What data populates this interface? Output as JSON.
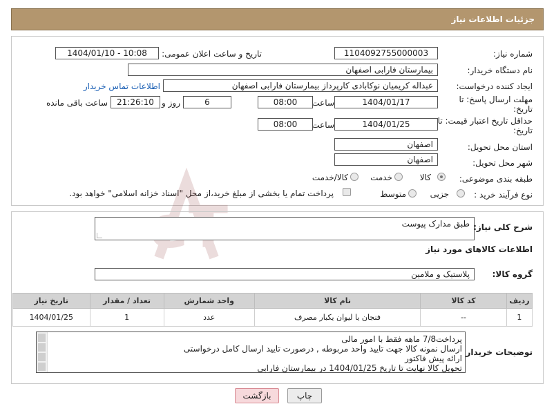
{
  "header": {
    "title": "جزئیات اطلاعات نیاز"
  },
  "form": {
    "need_number_label": "شماره نیاز:",
    "need_number": "1104092755000003",
    "announce_label": "تاریخ و ساعت اعلان عمومی:",
    "announce_value": "1404/01/10 - 10:08",
    "buyer_org_label": "نام دستگاه خریدار:",
    "buyer_org": "بیمارستان فارابی اصفهان",
    "creator_label": "ایجاد کننده درخواست:",
    "creator": "عبداله کریمیان نوکابادی کارپرداز بیمارستان فارابی اصفهان",
    "contact_link": "اطلاعات تماس خریدار",
    "deadline_label_1": "مهلت ارسال پاسخ: تا",
    "deadline_label_2": "تاریخ:",
    "deadline_date": "1404/01/17",
    "time_label": "ساعت",
    "deadline_time": "08:00",
    "days_value": "6",
    "days_label": "روز و",
    "remaining_time": "21:26:10",
    "remaining_label": "ساعت باقی مانده",
    "validity_label_1": "حداقل تاریخ اعتبار قیمت: تا",
    "validity_label_2": "تاریخ:",
    "validity_date": "1404/01/25",
    "validity_time": "08:00",
    "province_label": "استان محل تحویل:",
    "province": "اصفهان",
    "city_label": "شهر محل تحویل:",
    "city": "اصفهان",
    "category_label": "طبقه بندی موضوعی:",
    "category_options": [
      "کالا",
      "خدمت",
      "کالا/خدمت"
    ],
    "purchase_type_label": "نوع فرآیند خرید :",
    "purchase_options": [
      "جزیی",
      "متوسط"
    ],
    "payment_note": "پرداخت تمام یا بخشی از مبلغ خرید،از محل \"اسناد خزانه اسلامی\" خواهد بود."
  },
  "summary": {
    "description_label": "شرح کلی نیاز:",
    "description": "طبق مدارک پیوست",
    "goods_info_title": "اطلاعات کالاهای مورد نیاز",
    "goods_group_label": "گروه کالا:",
    "goods_group": "پلاستیک و ملامین"
  },
  "table": {
    "headers": [
      "ردیف",
      "کد کالا",
      "نام کالا",
      "واحد شمارش",
      "تعداد / مقدار",
      "تاریخ نیاز"
    ],
    "rows": [
      [
        "1",
        "--",
        "فنجان یا لیوان یکبار مصرف",
        "عدد",
        "1",
        "1404/01/25"
      ]
    ]
  },
  "notes": {
    "label": "توضیحات خریدار:",
    "lines": [
      "پرداخت7/8 ماهه فقط با امور مالی",
      "ارسال نمونه کالا جهت تایید واحد مربوطه , درصورت تایید ارسال کامل درخواستی",
      "ارائه پیش فاکتور",
      "تحویل کالا نهایت تا تاریخ 1404/01/25 در بیمارستان فارابی"
    ]
  },
  "buttons": {
    "print": "چاپ",
    "back": "بازگشت"
  },
  "watermark": {
    "text": "AriaTender.neT"
  },
  "colors": {
    "header_bg": "#b3966e",
    "link": "#1a5fb4",
    "back_button_bg": "#f7d9dc"
  }
}
